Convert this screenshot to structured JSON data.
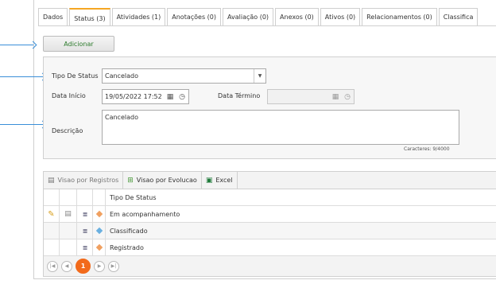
{
  "tabs": [
    {
      "label": "Dados"
    },
    {
      "label": "Status (3)",
      "active": true
    },
    {
      "label": "Atividades (1)"
    },
    {
      "label": "Anotações (0)"
    },
    {
      "label": "Avaliação (0)"
    },
    {
      "label": "Anexos (0)"
    },
    {
      "label": "Ativos (0)"
    },
    {
      "label": "Relacionamentos (0)"
    },
    {
      "label": "Classifica"
    }
  ],
  "add_button": {
    "label": "Adicionar"
  },
  "form": {
    "tipo_label": "Tipo De Status",
    "tipo_value": "Cancelado",
    "data_inicio_label": "Data Início",
    "data_inicio_value": "19/05/2022 17:52",
    "data_termino_label": "Data Término",
    "data_termino_value": "",
    "descricao_label": "Descrição",
    "descricao_value": "Cancelado",
    "counter": "Caracteres: 9/4000"
  },
  "grid": {
    "toolbar": {
      "registros": "Visao por Registros",
      "evolucao": "Visao por Evolucao",
      "excel": "Excel"
    },
    "column_header": "Tipo De Status",
    "rows": [
      {
        "status": "Em acompanhamento",
        "color": "#f0a060"
      },
      {
        "status": "Classificado",
        "color": "#6ab0e0"
      },
      {
        "status": "Registrado",
        "color": "#f0a060"
      }
    ],
    "pager": {
      "current_page": "1"
    }
  },
  "colors": {
    "accent": "#f26a1b",
    "arrow": "#3a8fd8",
    "tab_active": "#f5a623"
  }
}
